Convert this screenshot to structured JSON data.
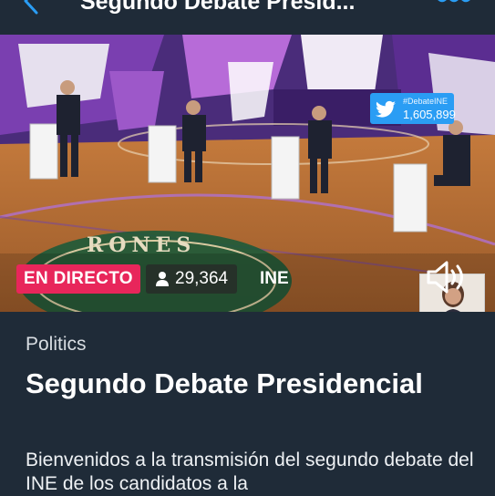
{
  "header": {
    "title": "Segundo Debate Presid..."
  },
  "video": {
    "twitter_hashtag": "#DebateINE",
    "twitter_count": "1,605,899",
    "live_label": "EN DIRECTO",
    "viewer_count": "29,364",
    "channel": "INE",
    "floor_text": "RONES"
  },
  "content": {
    "category": "Politics",
    "title": "Segundo Debate Presidencial",
    "description": "Bienvenidos a la transmisión del segundo debate del INE de los candidatos a la"
  },
  "colors": {
    "background": "#1f2b38",
    "accent_blue": "#2a9df4",
    "live_red": "#e8265b"
  }
}
